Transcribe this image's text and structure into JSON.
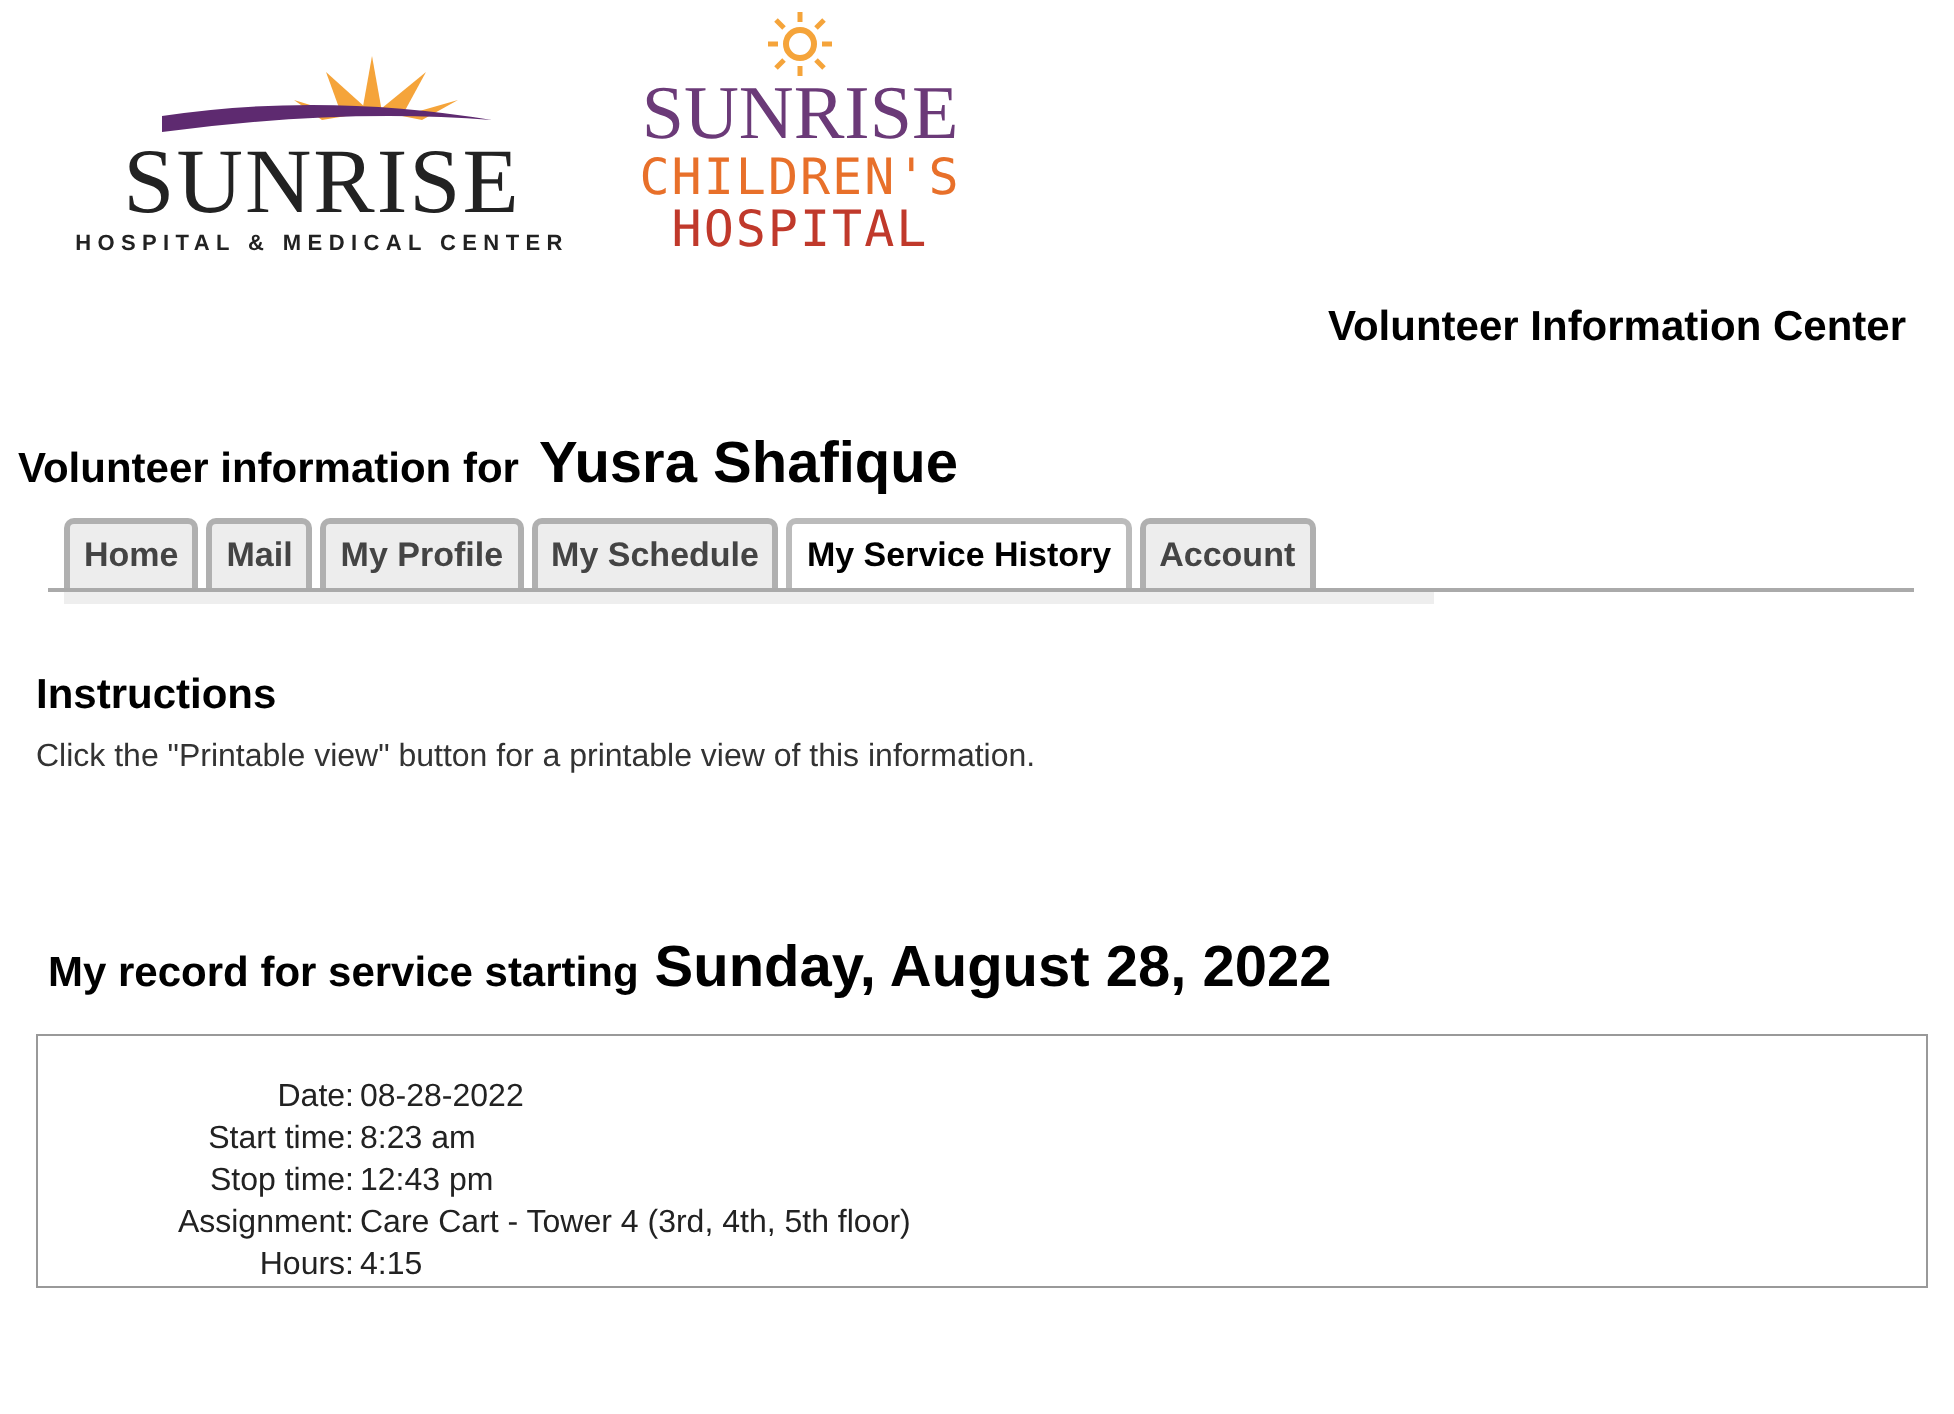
{
  "logos": [
    {
      "kind": "hospital",
      "name": "SUNRISE",
      "subtitle": "HOSPITAL & MEDICAL CENTER"
    },
    {
      "kind": "children",
      "name": "SUNRISE",
      "line_1": "CHILDREN'S",
      "line_2": "HOSPITAL"
    }
  ],
  "site_title": "Volunteer Information Center",
  "volunteer": {
    "label": "Volunteer information for",
    "name": "Yusra Shafique"
  },
  "tabs": [
    {
      "label": "Home",
      "selected": false
    },
    {
      "label": "Mail",
      "selected": false
    },
    {
      "label": "My Profile",
      "selected": false
    },
    {
      "label": "My Schedule",
      "selected": false
    },
    {
      "label": "My Service History",
      "selected": true
    },
    {
      "label": "Account",
      "selected": false
    }
  ],
  "instructions": {
    "heading": "Instructions",
    "text": "Click the \"Printable view\" button for a printable view of this information."
  },
  "record": {
    "label": "My record for service starting",
    "date": "Sunday, August 28, 2022",
    "fields": [
      {
        "label": "Date:",
        "value": "08-28-2022"
      },
      {
        "label": "Start time:",
        "value": "8:23 am"
      },
      {
        "label": "Stop time:",
        "value": "12:43 pm"
      },
      {
        "label": "Assignment:",
        "value": "Care Cart - Tower 4 (3rd, 4th, 5th floor)"
      },
      {
        "label": "Hours:",
        "value": "4:15"
      }
    ]
  }
}
